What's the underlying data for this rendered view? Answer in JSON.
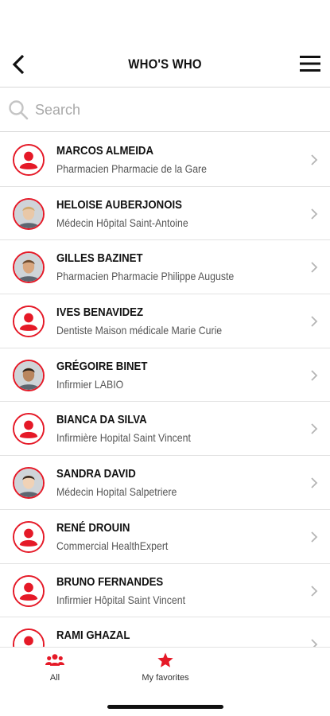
{
  "header": {
    "title": "WHO'S WHO"
  },
  "search": {
    "placeholder": "Search"
  },
  "contacts": [
    {
      "name": "MARCOS ALMEIDA",
      "subtitle": "Pharmacien Pharmacie de la Gare",
      "avatar": "default-avatar-icon"
    },
    {
      "name": "HELOISE AUBERJONOIS",
      "subtitle": "Médecin Hôpital Saint-Antoine",
      "avatar": "photo"
    },
    {
      "name": "GILLES BAZINET",
      "subtitle": "Pharmacien Pharmacie Philippe Auguste",
      "avatar": "photo"
    },
    {
      "name": "IVES BENAVIDEZ",
      "subtitle": "Dentiste Maison médicale Marie Curie",
      "avatar": "default-avatar-icon"
    },
    {
      "name": "GRÉGOIRE BINET",
      "subtitle": "Infirmier LABIO",
      "avatar": "photo"
    },
    {
      "name": "BIANCA DA SILVA",
      "subtitle": "Infirmière Hopital Saint Vincent",
      "avatar": "default-avatar-icon"
    },
    {
      "name": "SANDRA DAVID",
      "subtitle": "Médecin Hopital Salpetriere",
      "avatar": "photo"
    },
    {
      "name": "RENÉ DROUIN",
      "subtitle": "Commercial HealthExpert",
      "avatar": "default-avatar-icon"
    },
    {
      "name": "BRUNO FERNANDES",
      "subtitle": "Infirmier Hôpital Saint Vincent",
      "avatar": "default-avatar-icon"
    },
    {
      "name": "RAMI GHAZAL",
      "subtitle": "",
      "avatar": "default-avatar-icon"
    }
  ],
  "tabs": {
    "all_label": "All",
    "favorites_label": "My favorites"
  },
  "colors": {
    "accent": "#e51927",
    "text": "#111111",
    "subtext": "#555555",
    "divider": "#e2e2e2"
  }
}
